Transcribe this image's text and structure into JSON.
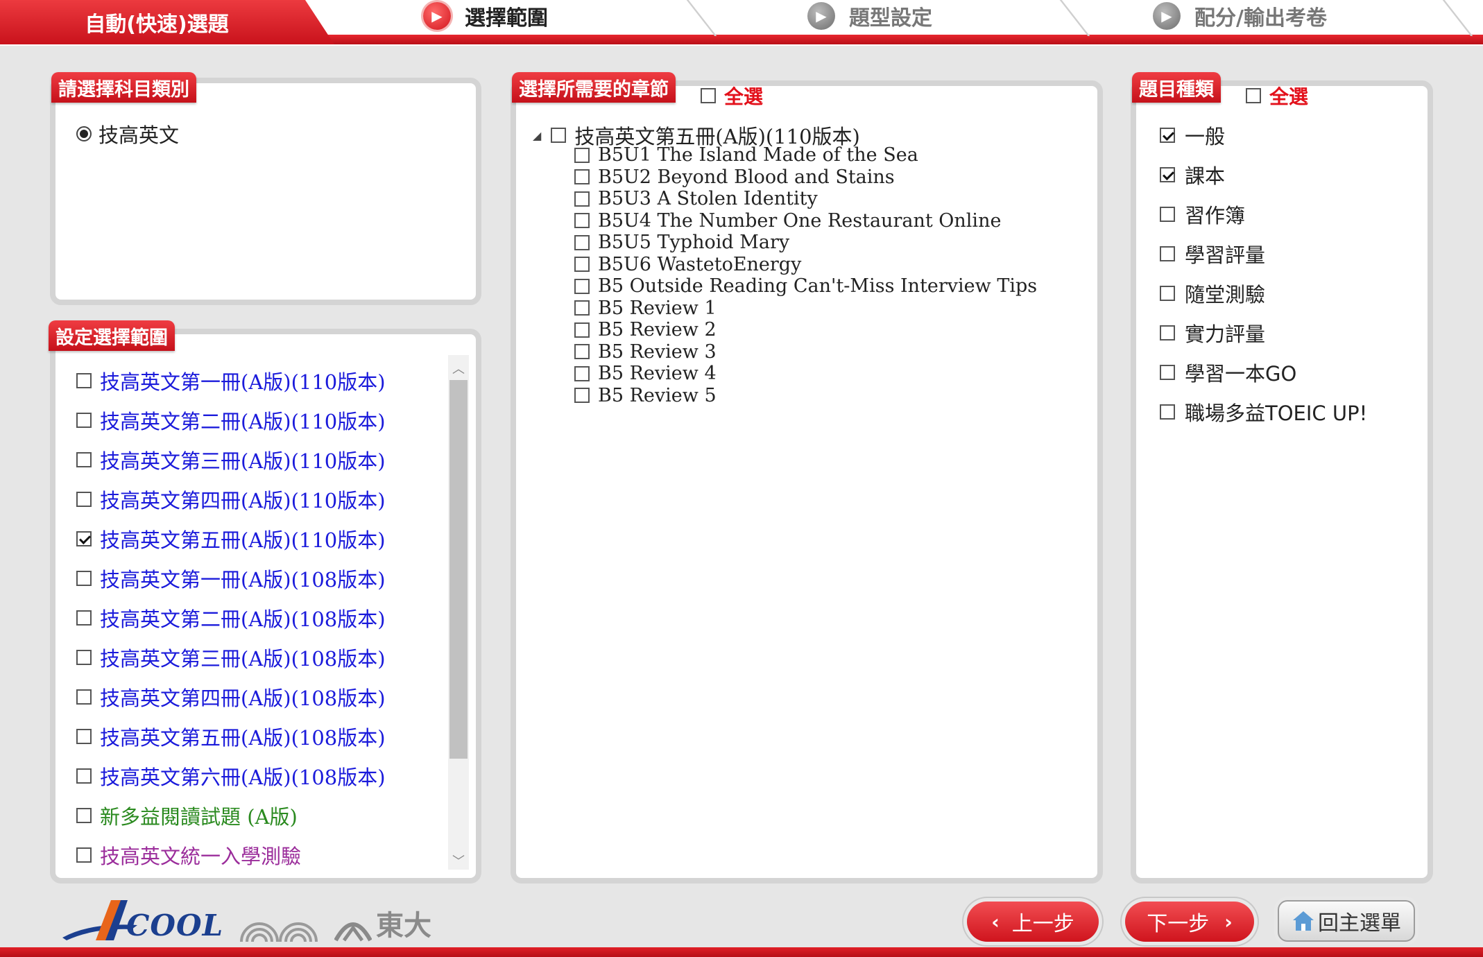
{
  "header": {
    "title": "自動(快速)選題",
    "steps": [
      {
        "label": "選擇範圍",
        "active": true
      },
      {
        "label": "題型設定",
        "active": false
      },
      {
        "label": "配分/輸出考卷",
        "active": false
      }
    ]
  },
  "subject_panel": {
    "title": "請選擇科目類別",
    "option": "技高英文",
    "selected": true
  },
  "range_panel": {
    "title": "設定選擇範圍",
    "items": [
      {
        "label": "技高英文第一冊(A版)(110版本)",
        "checked": false,
        "color": "#1a1adb"
      },
      {
        "label": "技高英文第二冊(A版)(110版本)",
        "checked": false,
        "color": "#1a1adb"
      },
      {
        "label": "技高英文第三冊(A版)(110版本)",
        "checked": false,
        "color": "#1a1adb"
      },
      {
        "label": "技高英文第四冊(A版)(110版本)",
        "checked": false,
        "color": "#1a1adb"
      },
      {
        "label": "技高英文第五冊(A版)(110版本)",
        "checked": true,
        "color": "#1a1adb"
      },
      {
        "label": "技高英文第一冊(A版)(108版本)",
        "checked": false,
        "color": "#1a1adb"
      },
      {
        "label": "技高英文第二冊(A版)(108版本)",
        "checked": false,
        "color": "#1a1adb"
      },
      {
        "label": "技高英文第三冊(A版)(108版本)",
        "checked": false,
        "color": "#1a1adb"
      },
      {
        "label": "技高英文第四冊(A版)(108版本)",
        "checked": false,
        "color": "#1a1adb"
      },
      {
        "label": "技高英文第五冊(A版)(108版本)",
        "checked": false,
        "color": "#1a1adb"
      },
      {
        "label": "技高英文第六冊(A版)(108版本)",
        "checked": false,
        "color": "#1a1adb"
      },
      {
        "label": "新多益閱讀試題 (A版)",
        "checked": false,
        "color": "#2a8a1f"
      },
      {
        "label": "技高英文統一入學測驗",
        "checked": false,
        "color": "#9b2d9b"
      }
    ]
  },
  "chapter_panel": {
    "title": "選擇所需要的章節",
    "select_all": "全選",
    "root": "技高英文第五冊(A版)(110版本)",
    "chapters": [
      "B5U1 The Island Made of the Sea",
      "B5U2 Beyond Blood and Stains",
      "B5U3 A Stolen Identity",
      "B5U4 The Number One Restaurant Online",
      "B5U5 Typhoid Mary",
      "B5U6 WastetoEnergy",
      "B5 Outside Reading Can't-Miss Interview Tips",
      "B5 Review 1",
      "B5 Review 2",
      "B5 Review 3",
      "B5 Review 4",
      "B5 Review 5"
    ]
  },
  "type_panel": {
    "title": "題目種類",
    "select_all": "全選",
    "items": [
      {
        "label": "一般",
        "checked": true
      },
      {
        "label": "課本",
        "checked": true
      },
      {
        "label": "習作簿",
        "checked": false
      },
      {
        "label": "學習評量",
        "checked": false
      },
      {
        "label": "隨堂測驗",
        "checked": false
      },
      {
        "label": "實力評量",
        "checked": false
      },
      {
        "label": "學習一本GO",
        "checked": false
      },
      {
        "label": "職場多益TOEIC UP!",
        "checked": false
      }
    ]
  },
  "footer": {
    "logo_cool": "COOL",
    "logo_dongda": "東大",
    "prev_label": "上一步",
    "next_label": "下一步",
    "home_label": "回主選單"
  },
  "colors": {
    "brand_red": "#d8161f",
    "link_blue": "#1a1adb",
    "panel_border": "#d4d4d4"
  }
}
